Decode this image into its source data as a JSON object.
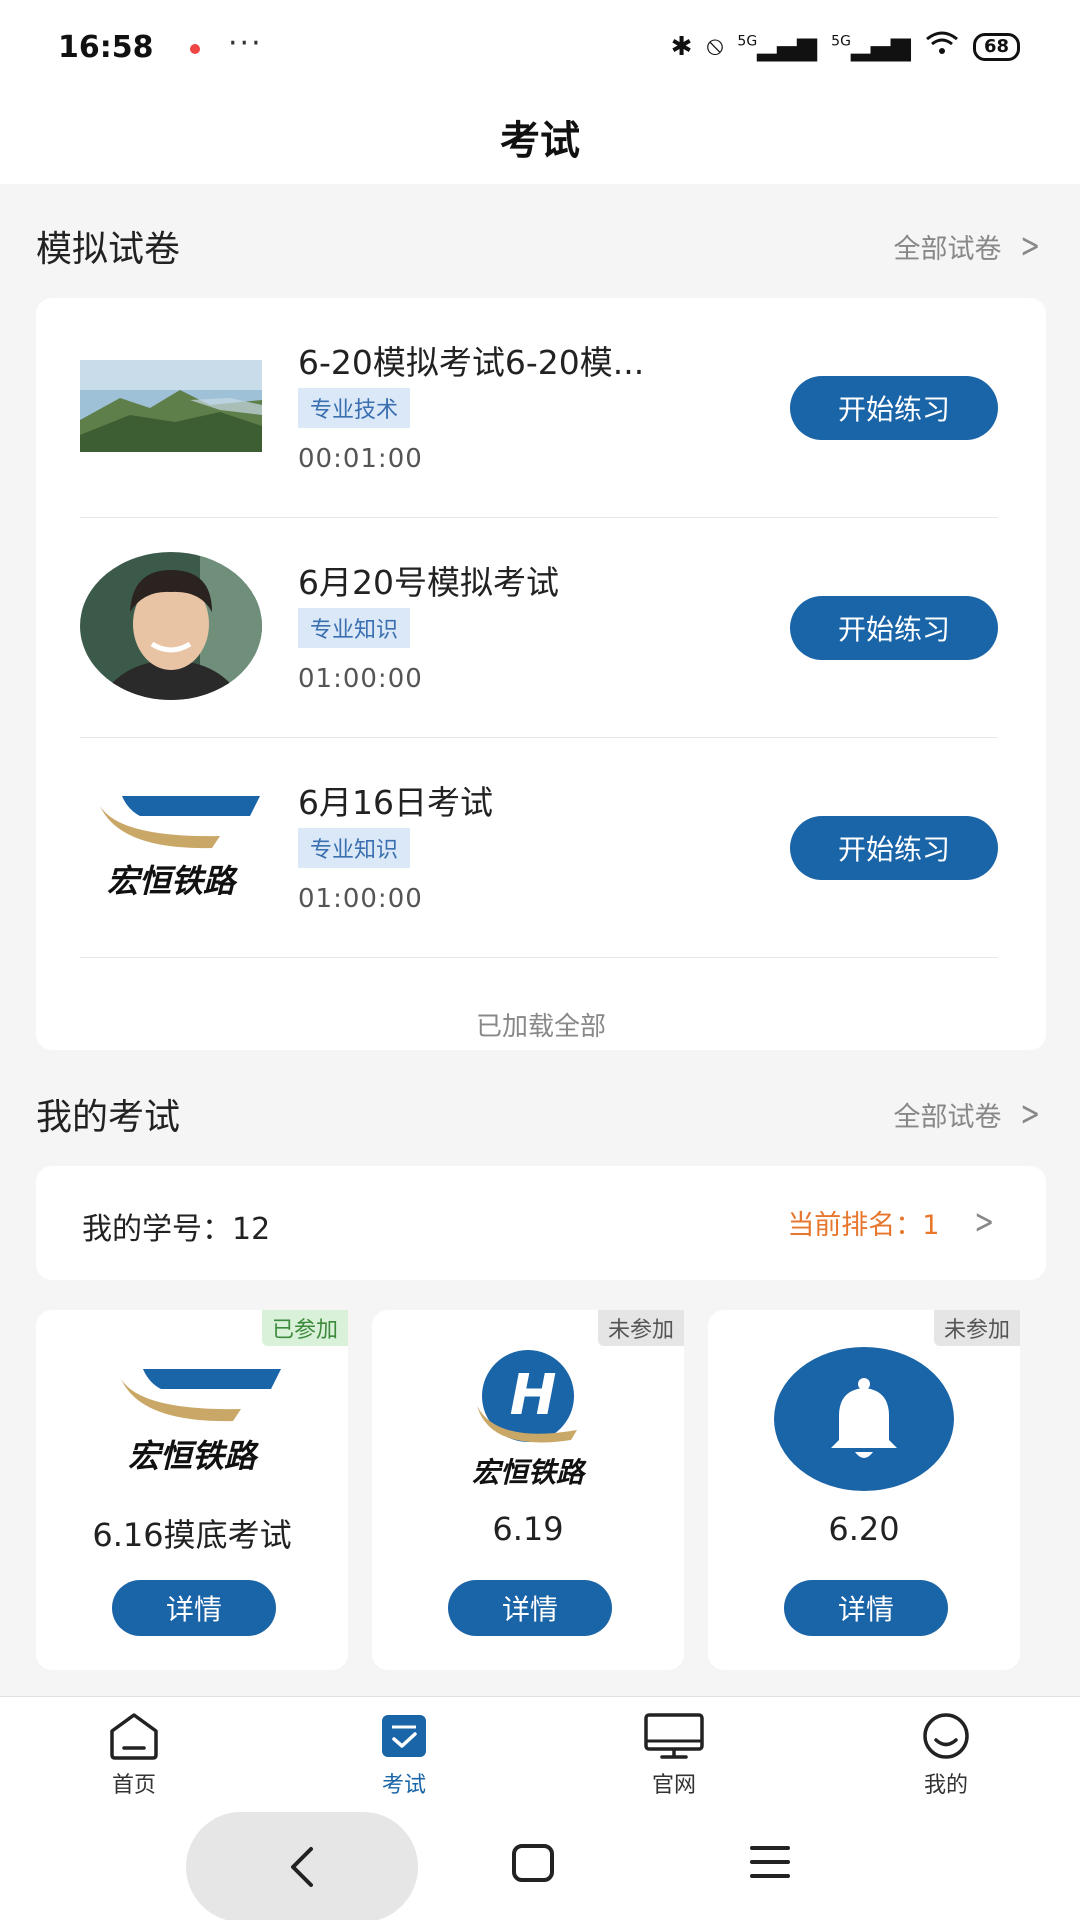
{
  "status_bar": {
    "time": "16:58",
    "more": "···",
    "signal_1": "5G",
    "signal_2": "5G",
    "battery": "68"
  },
  "page": {
    "title": "考试"
  },
  "mock_papers": {
    "section_title": "模拟试卷",
    "all_link": "全部试卷",
    "items": [
      {
        "title": "6-20模拟考试6-20模...",
        "tag": "专业技术",
        "duration": "00:01:00",
        "button": "开始练习",
        "thumb": "landscape"
      },
      {
        "title": "6月20号模拟考试",
        "tag": "专业知识",
        "duration": "01:00:00",
        "button": "开始练习",
        "thumb": "portrait"
      },
      {
        "title": "6月16日考试",
        "tag": "专业知识",
        "duration": "01:00:00",
        "button": "开始练习",
        "thumb": "logo"
      }
    ],
    "loaded_all": "已加载全部",
    "logo_text": "宏恒铁路"
  },
  "my_exams": {
    "section_title": "我的考试",
    "all_link": "全部试卷",
    "student_id": "我的学号：12",
    "rank": "当前排名：1",
    "cards": [
      {
        "badge": "已参加",
        "name": "6.16摸底考试",
        "button": "详情",
        "image": "logo",
        "logo_text": "宏恒铁路"
      },
      {
        "badge": "未参加",
        "name": "6.19",
        "button": "详情",
        "image": "h-logo",
        "logo_text": "宏恒铁路"
      },
      {
        "badge": "未参加",
        "name": "6.20",
        "button": "详情",
        "image": "bell"
      }
    ]
  },
  "tabbar": {
    "items": [
      {
        "label": "首页",
        "icon": "home-icon"
      },
      {
        "label": "考试",
        "icon": "exam-icon",
        "active": true
      },
      {
        "label": "官网",
        "icon": "monitor-icon"
      },
      {
        "label": "我的",
        "icon": "smile-icon"
      }
    ]
  },
  "colors": {
    "primary": "#1a64a8",
    "rank": "#e8772e",
    "tag_bg": "#dbe8f7",
    "logo_gold": "#c9a766"
  }
}
